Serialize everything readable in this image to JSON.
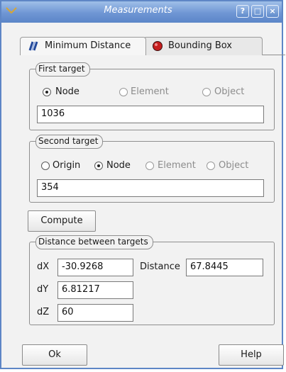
{
  "window": {
    "title": "Measurements"
  },
  "tabs": [
    {
      "label": "Minimum Distance",
      "active": true
    },
    {
      "label": "Bounding Box",
      "active": false
    }
  ],
  "first_target": {
    "title": "First target",
    "options": [
      {
        "label": "Node",
        "checked": true,
        "enabled": true
      },
      {
        "label": "Element",
        "checked": false,
        "enabled": false
      },
      {
        "label": "Object",
        "checked": false,
        "enabled": false
      }
    ],
    "value": "1036"
  },
  "second_target": {
    "title": "Second target",
    "options": [
      {
        "label": "Origin",
        "checked": false,
        "enabled": true
      },
      {
        "label": "Node",
        "checked": true,
        "enabled": true
      },
      {
        "label": "Element",
        "checked": false,
        "enabled": false
      },
      {
        "label": "Object",
        "checked": false,
        "enabled": false
      }
    ],
    "value": "354"
  },
  "compute_label": "Compute",
  "distance_group": {
    "title": "Distance between targets",
    "dx_label": "dX",
    "dx_value": "-30.9268",
    "dy_label": "dY",
    "dy_value": "6.81217",
    "dz_label": "dZ",
    "dz_value": "60",
    "distance_label": "Distance",
    "distance_value": "67.8445"
  },
  "footer": {
    "ok_label": "Ok",
    "help_label": "Help"
  },
  "colors": {
    "titlebar": "#6f96d4",
    "help_icon_border": "#e6eefb"
  },
  "icons": {
    "window_menu": "window-menu-icon",
    "tab1": "distance-icon",
    "tab2": "bounding-box-icon"
  }
}
